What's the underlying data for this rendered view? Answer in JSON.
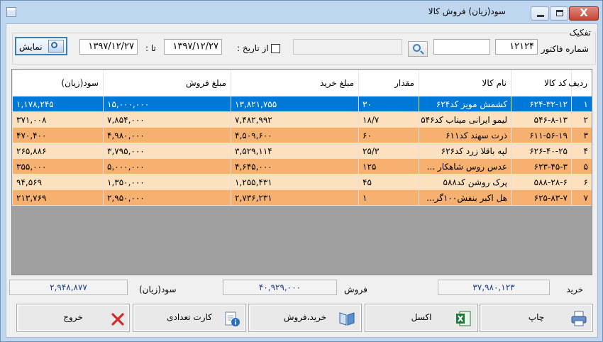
{
  "window": {
    "title": "سود(زیان) فروش کالا",
    "close_glyph": "X"
  },
  "filters": {
    "group_title": "تفکیک",
    "invoice_label": "شماره فاکتور",
    "invoice_value": "۱۲۱۲۴",
    "from_label": "از تاریخ :",
    "from_value": "۱۳۹۷/۱۲/۲۷",
    "to_label": "تا :",
    "to_value": "۱۳۹۷/۱۲/۲۷",
    "show_label": "نمایش",
    "text_value": "",
    "disabled_value": ""
  },
  "table": {
    "columns": [
      "ردیف",
      "کد کالا",
      "نام کالا",
      "مقدار",
      "مبلغ خرید",
      "مبلغ فروش",
      "سود(زیان)"
    ],
    "rows": [
      [
        "۱",
        "۶۲۴-۳۲-۱۲",
        "کشمش مویز کد۶۲۴",
        "۳۰",
        "۱۳,۸۲۱,۷۵۵",
        "۱۵,۰۰۰,۰۰۰",
        "۱,۱۷۸,۲۴۵"
      ],
      [
        "۲",
        "۵۴۶-۸-۱۳",
        "لیمو ایرانی میناب کد۵۴۶",
        "۱۸/۷",
        "۷,۴۸۲,۹۹۲",
        "۷,۸۵۴,۰۰۰",
        "۳۷۱,۰۰۸"
      ],
      [
        "۳",
        "۶۱۱-۵۶-۱۹",
        "ذرت سهند کد۶۱۱",
        "۶۰",
        "۴,۵۰۹,۶۰۰",
        "۴,۹۸۰,۰۰۰",
        "۴۷۰,۴۰۰"
      ],
      [
        "۴",
        "۶۲۶-۴۰-۲۵",
        "لپه باقلا زرد کد۶۲۶",
        "۲۵/۳",
        "۳,۵۲۹,۱۱۴",
        "۳,۷۹۵,۰۰۰",
        "۲۶۵,۸۸۶"
      ],
      [
        "۵",
        "۶۲۳-۴۵-۳",
        "عدس روس شاهکار ...",
        "۱۲۵",
        "۴,۶۴۵,۰۰۰",
        "۵,۰۰۰,۰۰۰",
        "۳۵۵,۰۰۰"
      ],
      [
        "۶",
        "۵۸۸-۲۸-۶",
        "پرک روشن کد۵۸۸",
        "۴۵",
        "۱,۲۵۵,۴۳۱",
        "۱,۳۵۰,۰۰۰",
        "۹۴,۵۶۹"
      ],
      [
        "۷",
        "۶۲۵-۸۳-۷",
        "هل اکبر بنفش۱۰۰گر...",
        "۱",
        "۲,۷۳۶,۲۳۱",
        "۲,۹۵۰,۰۰۰",
        "۲۱۳,۷۶۹"
      ]
    ]
  },
  "summary": {
    "purchase_label": "خرید",
    "purchase_value": "۳۷,۹۸۰,۱۲۳",
    "sales_label": "فروش",
    "sales_value": "۴۰,۹۲۹,۰۰۰",
    "profit_label": "سود(زیان)",
    "profit_value": "۲,۹۴۸,۸۷۷"
  },
  "actions": {
    "print": "چاپ",
    "excel": "اکسل",
    "buy_sell": "خرید،فروش",
    "count_card": "کارت تعدادی",
    "exit": "خروج"
  },
  "colors": {
    "selected_row": "#0078d7",
    "row_light": "#fde1bf",
    "row_dark": "#f6b171",
    "summary_text": "#1a3b8e"
  }
}
